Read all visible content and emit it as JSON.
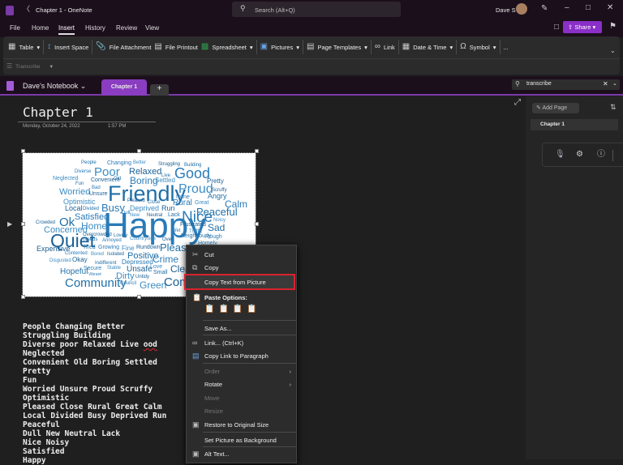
{
  "titlebar": {
    "title": "Chapter 1  -  OneNote",
    "search_placeholder": "Search (Alt+Q)",
    "user": "Dave S"
  },
  "menu_tabs": [
    "File",
    "Home",
    "Insert",
    "History",
    "Review",
    "View"
  ],
  "share_label": "Share",
  "ribbon": {
    "items": [
      "Table",
      "Insert Space",
      "File Attachment",
      "File Printout",
      "Spreadsheet",
      "Pictures",
      "Page Templates",
      "Link",
      "Date & Time",
      "Symbol",
      "..."
    ],
    "row2": "Transcribe"
  },
  "notebook": {
    "name": "Dave's Notebook",
    "section_tab": "Chapter 1",
    "add_tab": "+",
    "search_value": "transcribe"
  },
  "page": {
    "title": "Chapter 1",
    "date": "Monday, October 24, 2022",
    "time": "1:57 PM"
  },
  "right_pane": {
    "add_page": "Add Page",
    "page_item": "Chapter 1"
  },
  "word_cloud": [
    "People",
    "Changing",
    "Better",
    "Struggling",
    "Building",
    "Diverse",
    "Poor",
    "Relaxed",
    "Live",
    "Good",
    "Neglected",
    "Convenient",
    "Old",
    "Boring",
    "Settled",
    "Pretty",
    "Fun",
    "Bad",
    "Worried",
    "Unsure",
    "Friendly",
    "None",
    "Proud",
    "Scruffy",
    "Angry",
    "Calm",
    "Optimistic",
    "Pleased",
    "Close",
    "Rural",
    "Great",
    "Local",
    "Divided",
    "Busy",
    "Deprived",
    "Run",
    "Peaceful",
    "Dull",
    "New",
    "Neutral",
    "Lack",
    "Nice",
    "Noisy",
    "Crowded",
    "Ok",
    "Happy",
    "Home",
    "Frustrated",
    "Sad",
    "Satisfied",
    "Concerned",
    "Overcrowded",
    "Lovely",
    "Wet",
    "Traffic",
    "Quiet",
    "Needs",
    "Annoyed",
    "Countryside",
    "Over",
    "Neighbourly",
    "Rough",
    "Homely",
    "Expensive",
    "Tired",
    "Growing",
    "Fine",
    "Rundown",
    "Pleasant",
    "Contented",
    "Bored",
    "Isolated",
    "Positive",
    "Crime",
    "Disgusted",
    "Okay",
    "Indifferent",
    "Depressed",
    "Love",
    "Clean",
    "Hopeful",
    "Secure",
    "Stable",
    "Unsafe",
    "Small",
    "Vibrant",
    "Dirty",
    "Untidy",
    "Community",
    "Council",
    "Green",
    "Community"
  ],
  "context_menu": {
    "cut": "Cut",
    "copy": "Copy",
    "copy_text": "Copy Text from Picture",
    "paste_options": "Paste Options:",
    "save_as": "Save As...",
    "link": "Link...  (Ctrl+K)",
    "copy_link": "Copy Link to Paragraph",
    "order": "Order",
    "rotate": "Rotate",
    "move": "Move",
    "resize": "Resize",
    "restore": "Restore to Original Size",
    "set_bg": "Set Picture as Background",
    "alt_text": "Alt Text..."
  },
  "extracted_text": [
    "People Changing Better",
    "Struggling Building",
    "Diverse poor Relaxed Live ood",
    "Neglected",
    "Convenient Old Boring Settled",
    "Pretty",
    "Fun",
    "Worried Unsure Proud Scruffy",
    "Optimistic",
    "Pleased Close Rural Great Calm",
    "Local Divided Busy Deprived Run",
    "Peaceful",
    "Dull New Neutral Lack",
    "Nice Noisy",
    "Satisfied",
    "Happy"
  ],
  "colors": {
    "accent": "#7a3aa8",
    "highlight": "#d9232e",
    "cloud_text": "#1f6fa8"
  }
}
